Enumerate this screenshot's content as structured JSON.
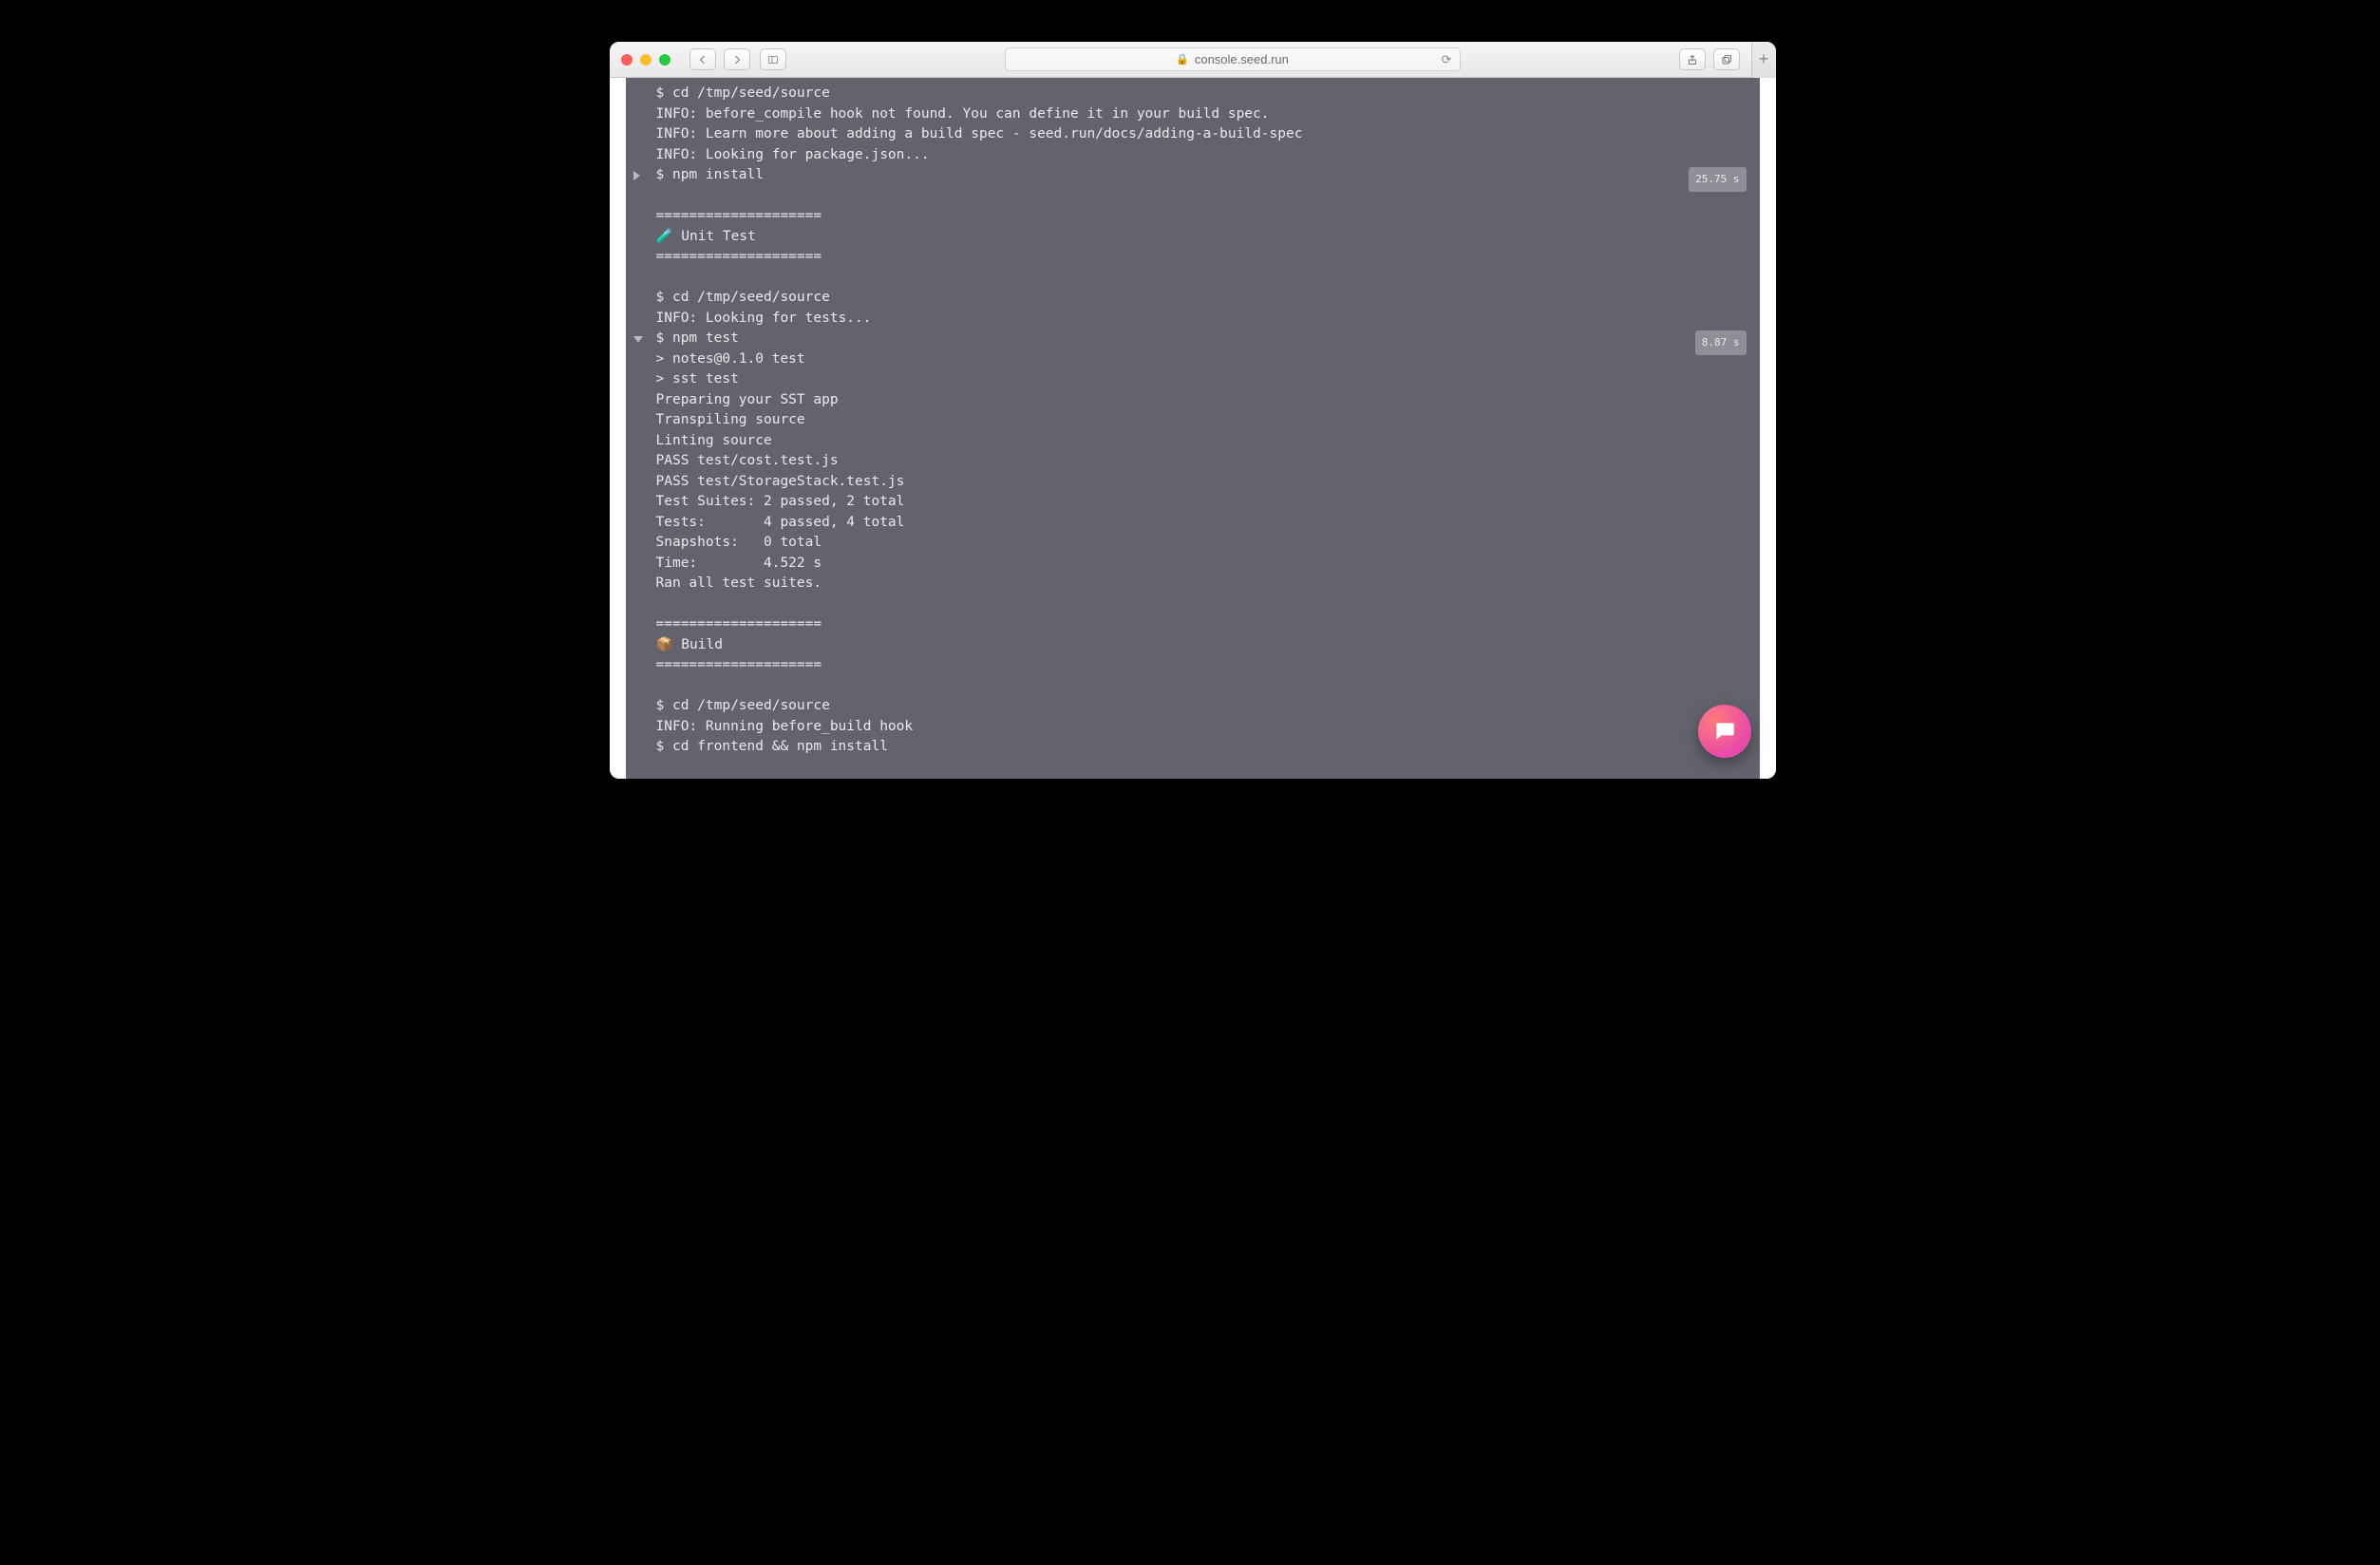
{
  "browser": {
    "address": "console.seed.run"
  },
  "terminal": {
    "lines": [
      {
        "text": "$ cd /tmp/seed/source"
      },
      {
        "text": "INFO: before_compile hook not found. You can define it in your build spec."
      },
      {
        "text": "INFO: Learn more about adding a build spec - seed.run/docs/adding-a-build-spec"
      },
      {
        "text": "INFO: Looking for package.json..."
      },
      {
        "text": "$ npm install",
        "fold": "right",
        "badge": "25.75 s"
      },
      {
        "text": ""
      },
      {
        "text": "===================="
      },
      {
        "text": "🧪 Unit Test"
      },
      {
        "text": "===================="
      },
      {
        "text": ""
      },
      {
        "text": "$ cd /tmp/seed/source"
      },
      {
        "text": "INFO: Looking for tests..."
      },
      {
        "text": "$ npm test",
        "fold": "down",
        "badge": "8.87 s"
      },
      {
        "text": "> notes@0.1.0 test"
      },
      {
        "text": "> sst test"
      },
      {
        "text": "Preparing your SST app"
      },
      {
        "text": "Transpiling source"
      },
      {
        "text": "Linting source"
      },
      {
        "text": "PASS test/cost.test.js"
      },
      {
        "text": "PASS test/StorageStack.test.js"
      },
      {
        "text": "Test Suites: 2 passed, 2 total"
      },
      {
        "text": "Tests:       4 passed, 4 total"
      },
      {
        "text": "Snapshots:   0 total"
      },
      {
        "text": "Time:        4.522 s"
      },
      {
        "text": "Ran all test suites."
      },
      {
        "text": ""
      },
      {
        "text": "===================="
      },
      {
        "text": "📦 Build"
      },
      {
        "text": "===================="
      },
      {
        "text": ""
      },
      {
        "text": "$ cd /tmp/seed/source"
      },
      {
        "text": "INFO: Running before_build hook"
      },
      {
        "text": "$ cd frontend && npm install"
      }
    ]
  }
}
